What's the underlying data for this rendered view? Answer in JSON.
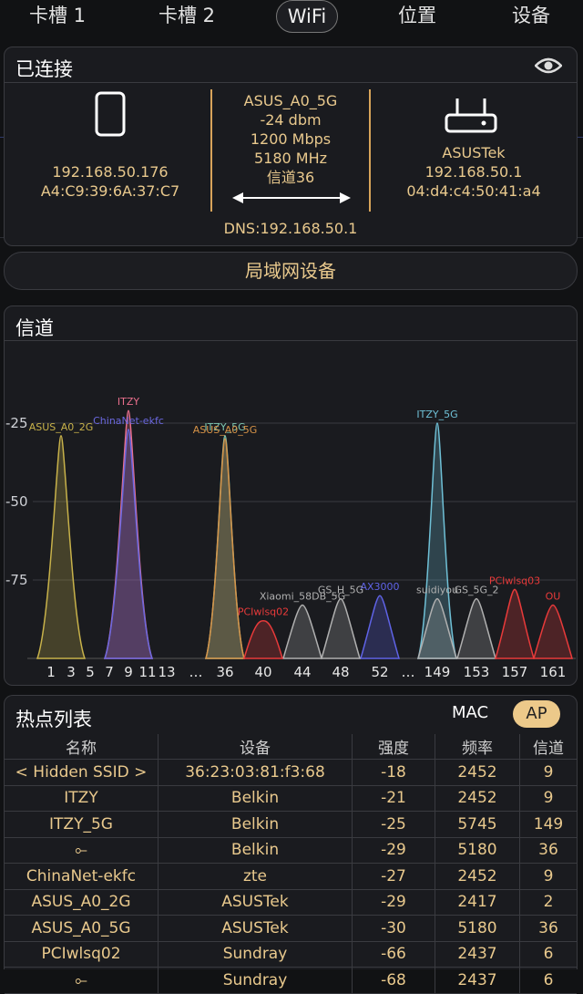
{
  "tabs": [
    {
      "label": "卡槽 1"
    },
    {
      "label": "卡槽 2"
    },
    {
      "label": "WiFi"
    },
    {
      "label": "位置"
    },
    {
      "label": "设备"
    }
  ],
  "connected": {
    "title": "已连接",
    "phone": {
      "ip": "192.168.50.176",
      "mac": "A4:C9:39:6A:37:C7"
    },
    "link": {
      "ssid": "ASUS_A0_5G",
      "signal": "-24 dbm",
      "speed": "1200 Mbps",
      "freq": "5180 MHz",
      "channel": "信道36",
      "dns": "DNS:192.168.50.1"
    },
    "router": {
      "vendor": "ASUSTek",
      "ip": "192.168.50.1",
      "mac": "04:d4:c4:50:41:a4"
    }
  },
  "lan_button": "局域网设备",
  "channel_panel": {
    "title": "信道",
    "y_ticks": [
      "-25",
      "-50",
      "-75"
    ],
    "x_ticks": [
      "1",
      "3",
      "5",
      "7",
      "9",
      "11",
      "13",
      "…",
      "36",
      "40",
      "44",
      "48",
      "52",
      "…",
      "149",
      "153",
      "157",
      "161"
    ]
  },
  "chart_data": {
    "type": "area",
    "title": "信道",
    "ylim": [
      -100,
      -15
    ],
    "y_ticks": [
      -25,
      -50,
      -75
    ],
    "x_ticks": [
      "1",
      "3",
      "5",
      "7",
      "9",
      "11",
      "13",
      "…",
      "36",
      "40",
      "44",
      "48",
      "52",
      "…",
      "149",
      "153",
      "157",
      "161"
    ],
    "networks": [
      {
        "ssid": "ITZY",
        "channel": "9",
        "dbm": -21,
        "color": "#e96f8c"
      },
      {
        "ssid": "ASUS_A0_2G",
        "channel": "2",
        "dbm": -29,
        "color": "#c8b24a"
      },
      {
        "ssid": "ITZY_5G",
        "channel": "36",
        "dbm": -29,
        "color": "#7fc9b2"
      },
      {
        "ssid": "ASUS_A0_5G",
        "channel": "36",
        "dbm": -30,
        "color": "#d79347"
      },
      {
        "ssid": "ITZY_5G",
        "channel": "149",
        "dbm": -25,
        "color": "#6fc0d6"
      },
      {
        "ssid": "ChinaNet-ekfc",
        "channel": "9",
        "dbm": -27,
        "color": "#6b68e0"
      },
      {
        "ssid": "AX3000",
        "channel": "52",
        "dbm": -80,
        "color": "#5f63e6"
      },
      {
        "ssid": "suidiyou",
        "channel": "149",
        "dbm": -81,
        "color": "#b0b0b0"
      },
      {
        "ssid": "GS_5G_2",
        "channel": "153",
        "dbm": -81,
        "color": "#b0b0b0"
      },
      {
        "ssid": "GS_H_5G",
        "channel": "48",
        "dbm": -81,
        "color": "#b0b0b0"
      },
      {
        "ssid": "Xiaomi_58DB_5G",
        "channel": "44",
        "dbm": -83,
        "color": "#b0b0b0"
      },
      {
        "ssid": "PCIwlsq03",
        "channel": "157",
        "dbm": -78,
        "color": "#e83a3a"
      },
      {
        "ssid": "OU",
        "channel": "161",
        "dbm": -83,
        "color": "#e83a3a"
      },
      {
        "ssid": "PCIwlsq02",
        "channel": "40",
        "dbm": -88,
        "color": "#e83a3a"
      }
    ]
  },
  "hotspot": {
    "title": "热点列表",
    "mac_label": "MAC",
    "ap_label": "AP",
    "columns": [
      "名称",
      "设备",
      "强度",
      "频率",
      "信道"
    ],
    "rows": [
      [
        "< Hidden SSID >",
        "36:23:03:81:f3:68",
        "-18",
        "2452",
        "9"
      ],
      [
        "ITZY",
        "Belkin",
        "-21",
        "2452",
        "9"
      ],
      [
        "ITZY_5G",
        "Belkin",
        "-25",
        "5745",
        "149"
      ],
      [
        "⟜",
        "Belkin",
        "-29",
        "5180",
        "36"
      ],
      [
        "ChinaNet-ekfc",
        "zte",
        "-27",
        "2452",
        "9"
      ],
      [
        "ASUS_A0_2G",
        "ASUSTek",
        "-29",
        "2417",
        "2"
      ],
      [
        "ASUS_A0_5G",
        "ASUSTek",
        "-30",
        "5180",
        "36"
      ],
      [
        "PCIwlsq02",
        "Sundray",
        "-66",
        "2437",
        "6"
      ],
      [
        "⟜",
        "Sundray",
        "-68",
        "2437",
        "6"
      ]
    ]
  }
}
